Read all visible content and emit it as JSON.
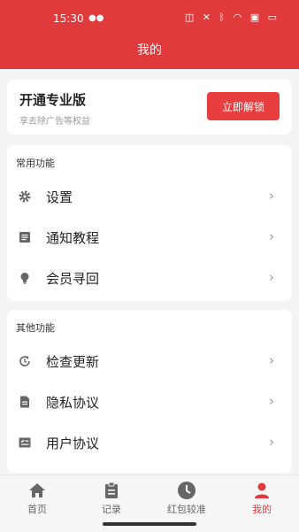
{
  "colors": {
    "accent": "#e03a3c",
    "icon_gray": "#666666",
    "chevron": "#999999"
  },
  "status_bar": {
    "time": "15:30"
  },
  "header": {
    "title": "我的"
  },
  "promo": {
    "title": "开通专业版",
    "subtitle": "享去除广告等权益",
    "button": "立即解锁"
  },
  "sections": [
    {
      "title": "常用功能",
      "items": [
        {
          "label": "设置",
          "icon": "gear-icon"
        },
        {
          "label": "通知教程",
          "icon": "document-icon"
        },
        {
          "label": "会员寻回",
          "icon": "bulb-icon"
        }
      ]
    },
    {
      "title": "其他功能",
      "items": [
        {
          "label": "检查更新",
          "icon": "refresh-icon"
        },
        {
          "label": "隐私协议",
          "icon": "file-icon"
        },
        {
          "label": "用户协议",
          "icon": "list-check-icon"
        }
      ]
    }
  ],
  "tabbar": [
    {
      "label": "首页",
      "icon": "home-icon",
      "active": false
    },
    {
      "label": "记录",
      "icon": "clipboard-icon",
      "active": false
    },
    {
      "label": "红包较准",
      "icon": "clock-icon",
      "active": false
    },
    {
      "label": "我的",
      "icon": "user-icon",
      "active": true
    }
  ]
}
